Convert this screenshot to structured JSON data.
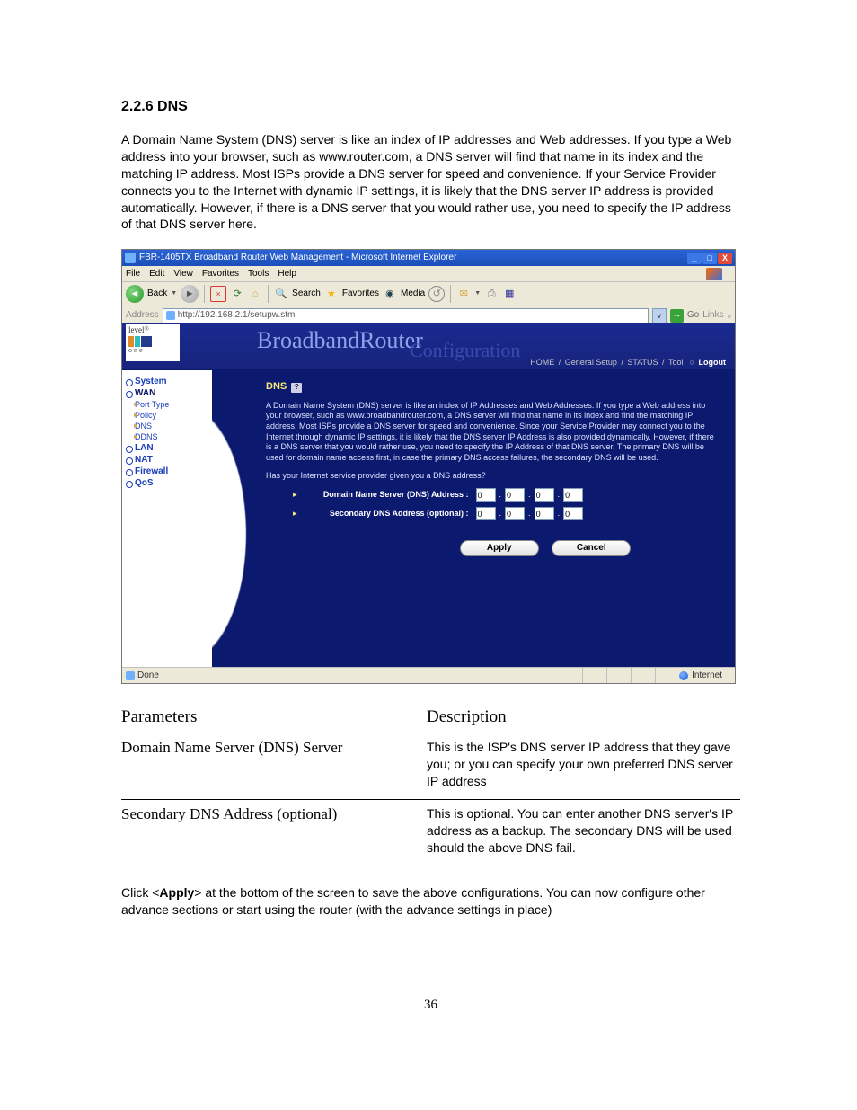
{
  "doc": {
    "section_number": "2.2.6 DNS",
    "intro": "A Domain Name System (DNS) server is like an index of IP addresses and Web addresses. If you type a Web address into your browser, such as www.router.com, a DNS server will find that name in its index and the matching IP address. Most ISPs provide a DNS server for speed and convenience. If your Service Provider connects you to the Internet with dynamic IP settings, it is likely that the DNS server IP address is provided automatically. However, if there is a DNS server that you would rather use, you need to specify the IP address of that DNS server here.",
    "page_number": "36",
    "closing": "Click <Apply> at the bottom of the screen to save the above configurations. You can now configure other advance sections or start using the router (with the advance settings in place)",
    "params_head_left": "Parameters",
    "params_head_right": "Description",
    "params": [
      {
        "name": "Domain Name Server (DNS) Server",
        "desc": "This is the ISP's DNS server IP address that they gave you; or you can specify your own preferred DNS server IP address"
      },
      {
        "name": "Secondary DNS Address (optional)",
        "desc": "This is optional. You can enter another DNS server's IP address as a backup. The secondary DNS will be used should the above DNS fail."
      }
    ]
  },
  "ie": {
    "title": "FBR-1405TX Broadband Router Web Management - Microsoft Internet Explorer",
    "menu": {
      "file": "File",
      "edit": "Edit",
      "view": "View",
      "favorites": "Favorites",
      "tools": "Tools",
      "help": "Help"
    },
    "toolbar": {
      "back": "Back",
      "search": "Search",
      "favorites": "Favorites",
      "media": "Media"
    },
    "address_label": "Address",
    "url": "http://192.168.2.1/setupw.stm",
    "go": "Go",
    "links": "Links",
    "status_done": "Done",
    "status_zone": "Internet"
  },
  "router": {
    "logo_brand": "level",
    "logo_one": "one",
    "banner_title": "BroadbandRouter",
    "banner_sub": "Configuration",
    "top_links": {
      "home": "HOME",
      "setup": "General Setup",
      "status": "STATUS",
      "tool": "Tool",
      "logout": "Logout"
    },
    "nav": {
      "system": "System",
      "wan": "WAN",
      "port_type": "Port Type",
      "policy": "Policy",
      "dns": "DNS",
      "ddns": "DDNS",
      "lan": "LAN",
      "nat": "NAT",
      "firewall": "Firewall",
      "qos": "QoS"
    },
    "heading": "DNS",
    "help_q": "?",
    "desc": "A Domain Name System (DNS) server is like an index of IP Addresses and Web Addresses. If you type a Web address into your browser, such as www.broadbandrouter.com, a DNS server will find that name in its index and find the matching IP address. Most ISPs provide a DNS server for speed and convenience. Since your Service Provider may connect you to the Internet through dynamic IP settings, it is likely that the DNS server IP Address is also provided dynamically. However, if there is a DNS server that you would rather use, you need to specify the IP Address of that DNS server. The primary DNS will be used for domain name access first, in case the primary DNS access failures, the secondary DNS will be used.",
    "prompt": "Has your Internet service provider given you a DNS address?",
    "row1_label": "Domain Name Server (DNS) Address  :",
    "row2_label": "Secondary DNS Address (optional)  :",
    "ip": {
      "a": "0",
      "b": "0",
      "c": "0",
      "d": "0"
    },
    "ip2": {
      "a": "0",
      "b": "0",
      "c": "0",
      "d": "0"
    },
    "btn_apply": "Apply",
    "btn_cancel": "Cancel"
  }
}
